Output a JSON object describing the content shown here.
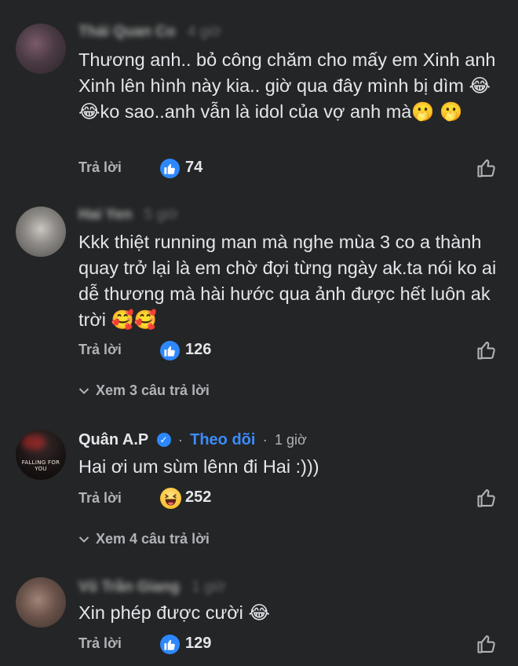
{
  "comments": [
    {
      "author": "Thái Quan Co",
      "time": "4 giờ",
      "text_parts": [
        "Thương anh.. bỏ công chăm cho mấy em Xinh anh Xinh lên hình này kia.. giờ qua đây mình bị dìm ",
        "😂",
        "😂",
        "ko sao..anh vẫn là idol của vợ anh mà",
        "🫢",
        "🫢"
      ],
      "reply_label": "Trả lời",
      "reaction_icon": "like-icon",
      "reaction_count": "74"
    },
    {
      "author": "Hai Yen",
      "time": "5 giờ",
      "text_parts": [
        "Kkk thiệt running man mà nghe mùa 3 co a thành quay trở lại là em chờ đợi từng ngày ak.ta nói ko ai dễ thương mà hài hước qua ảnh được hết luôn ak trời ",
        "🥰",
        "🥰"
      ],
      "reply_label": "Trả lời",
      "reaction_icon": "like-icon",
      "reaction_count": "126",
      "view_replies": "Xem 3 câu trả lời"
    },
    {
      "author": "Quân A.P",
      "verified": true,
      "follow_label": "Theo dõi",
      "time": "1 giờ",
      "avatar_text": "FALLING FOR YOU",
      "text_parts": [
        "Hai ơi um sùm lênn đi Hai :)))"
      ],
      "reply_label": "Trả lời",
      "reaction_icon": "haha-icon",
      "reaction_count": "252",
      "view_replies": "Xem 4 câu trả lời"
    },
    {
      "author": "Vũ Trần Giang",
      "time": "1 giờ",
      "text_parts": [
        "Xin phép được cười ",
        "😂"
      ],
      "reply_label": "Trả lời",
      "reaction_icon": "like-icon",
      "reaction_count": "129"
    }
  ],
  "colors": {
    "background": "#242526",
    "text": "#e4e6eb",
    "muted": "#b0b3b8",
    "accent": "#2d88ff"
  }
}
